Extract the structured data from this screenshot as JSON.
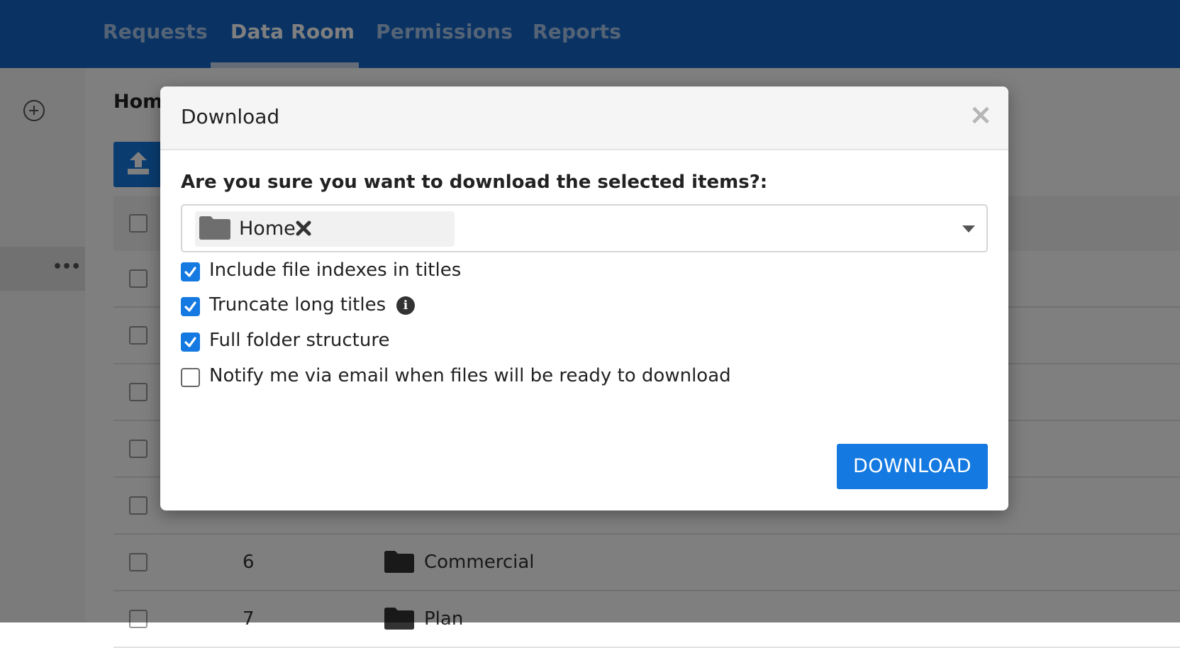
{
  "nav": {
    "tabs": [
      {
        "label": "Requests",
        "active": false
      },
      {
        "label": "Data Room",
        "active": true
      },
      {
        "label": "Permissions",
        "active": false
      },
      {
        "label": "Reports",
        "active": false
      }
    ]
  },
  "background": {
    "breadcrumb": "Home",
    "rows": [
      {
        "num": "6",
        "name": "Commercial"
      },
      {
        "num": "7",
        "name": "Plan"
      }
    ]
  },
  "modal": {
    "title": "Download",
    "close_label": "×",
    "question": "Are you sure you want to download the selected items?:",
    "selected_item": "Home",
    "options": [
      {
        "label": "Include file indexes in titles",
        "checked": true
      },
      {
        "label": "Truncate long titles",
        "checked": true,
        "info": "i"
      },
      {
        "label": "Full folder structure",
        "checked": true
      },
      {
        "label": "Notify me via email when files will be ready to download",
        "checked": false
      }
    ],
    "download_label": "DOWNLOAD"
  },
  "colors": {
    "nav_bg": "#1467c8",
    "primary": "#1479e0",
    "overlay": "rgba(0,0,0,0.5)"
  }
}
